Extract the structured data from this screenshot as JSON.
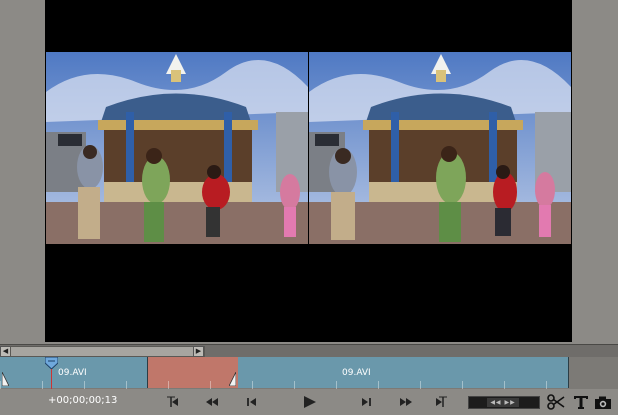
{
  "timeline": {
    "clips": [
      {
        "label": "09.AVI"
      },
      {
        "label": "09.AVI"
      }
    ]
  },
  "controls": {
    "timecode": "+00;00;00;13"
  },
  "icons": {
    "prev_edit": "go-to-previous-edit-icon",
    "rewind": "rewind-icon",
    "step_back": "step-back-icon",
    "play": "play-icon",
    "step_forward": "step-forward-icon",
    "fast_forward": "fast-forward-icon",
    "next_edit": "go-to-next-edit-icon",
    "split": "scissors-icon",
    "title": "text-title-icon",
    "snapshot": "camera-icon"
  },
  "colors": {
    "clip": "#6a98ab",
    "selected_region": "#c0776a",
    "playhead": "#c33333"
  }
}
